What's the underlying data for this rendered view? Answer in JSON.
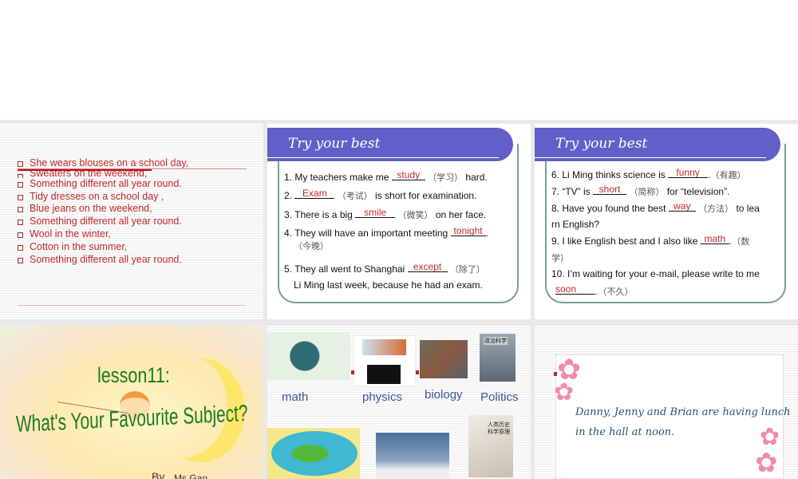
{
  "slide1": {
    "bullets": [
      "She wears blouses on a school day,",
      "Sweaters on the weekend,",
      "Something different all year round.",
      "Tidy dresses on a school day ,",
      "Blue jeans on the weekend,",
      "Something different all year round.",
      "Wool in the winter,",
      "Cotton in the summer,",
      "Something different all year round."
    ]
  },
  "slide2": {
    "header": "Try your best",
    "q1": {
      "pre": "1. My teachers make me",
      "ans": "study",
      "cn": "（学习）",
      "post": "hard."
    },
    "q2": {
      "pre": "2.",
      "ans": "Exam",
      "cn": "（考试）",
      "post": "is short for examination."
    },
    "q3": {
      "pre": "3. There is a big",
      "ans": "smile",
      "cn": "（微笑）",
      "post": "on her face."
    },
    "q4": {
      "pre": "4. They will have an important meeting",
      "ans": "tonight",
      "post": ".",
      "cn": "（今晚）"
    },
    "q5": {
      "pre": "5. They all went to Shanghai",
      "ans": "except",
      "cn": "（除了）",
      "line2": "Li Ming last week, because he had an exam."
    }
  },
  "slide3": {
    "header": "Try your best",
    "q6": {
      "pre": "6. Li Ming thinks science is",
      "ans": "funny",
      "cn": ".（有趣）"
    },
    "q7": {
      "pre": "7. “TV” is",
      "ans": "short",
      "cn": "（简称）",
      "post": "for “television”."
    },
    "q8": {
      "pre": "8. Have you found the best",
      "ans": "way",
      "cn": "（方法）",
      "post": "to lea",
      "line2": "rn English?"
    },
    "q9": {
      "pre": "9. I like English best and I also like",
      "ans": "math",
      "cn": ".（数",
      "line2": "学）"
    },
    "q10": {
      "pre": "10. I’m waiting for your e-mail, please write to me",
      "ans": "soon",
      "cn": ".（不久）"
    }
  },
  "slide4": {
    "lesson": "lesson11:",
    "title": "What's Your Favourite Subject?",
    "by": "By",
    "author": "Ms Gao"
  },
  "slide5": {
    "labels": [
      "math",
      "physics",
      "biology",
      "Politics"
    ],
    "book_cn": "人类历史\n科学原理",
    "book2": "政治科学"
  },
  "slide6": {
    "line1": "Danny, Jenny and Brian are having lunch",
    "line2": "in the hall at noon."
  }
}
